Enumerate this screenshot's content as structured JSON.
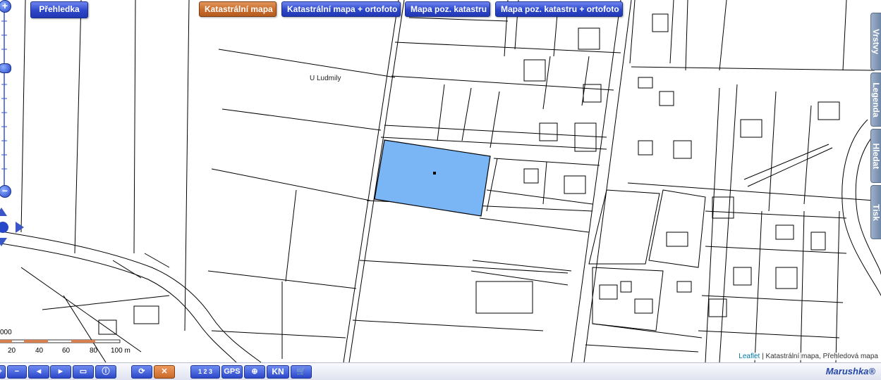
{
  "buttons": {
    "overview": "Přehledka",
    "cadastral": "Katastrální mapa",
    "cadastral_ortho": "Katastrální mapa + ortofoto",
    "pos_map": "Mapa poz. katastru",
    "pos_map_ortho": "Mapa poz. katastru + ortofoto"
  },
  "side_tabs": [
    "Vrstvy",
    "Legenda",
    "Hledat",
    "Tisk"
  ],
  "map_labels": {
    "u_ludmily": "U Ludmily"
  },
  "scale": {
    "ticks": [
      "20",
      "40",
      "60",
      "80",
      "100 m"
    ],
    "left_fragment": "000"
  },
  "attribution": {
    "link": "Leaflet",
    "text": "| Katastrální mapa, Přehledová mapa"
  },
  "toolbar": {
    "gps": "GPS",
    "kn": "KN",
    "numbering": "1 2 3",
    "brand": "Marushka®"
  },
  "colors": {
    "selected_parcel": "#7ab6f5",
    "button_blue": "#2c47c9",
    "button_active": "#c96a29"
  }
}
